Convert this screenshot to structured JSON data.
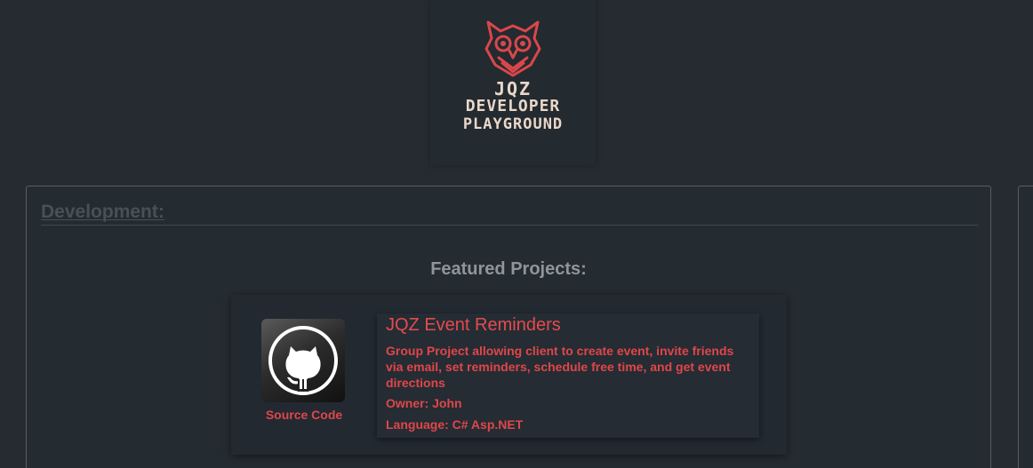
{
  "logo": {
    "line1": "JQZ",
    "line2": "DEVELOPER",
    "line3": "PLAYGROUND",
    "icon": "owl-icon"
  },
  "section": {
    "title": "Development:",
    "featured_heading": "Featured Projects:"
  },
  "project": {
    "title": "JQZ Event Reminders",
    "description": "Group Project allowing client to create event, invite friends via email, set reminders, schedule free time, and get event directions",
    "owner": "Owner: John",
    "language": "Language: C# Asp.NET",
    "source_label": "Source Code",
    "source_icon": "github-icon"
  },
  "colors": {
    "background": "#252b31",
    "accent": "#e0464a",
    "logo_text": "#ead7c9",
    "muted_text": "#8f959b"
  }
}
